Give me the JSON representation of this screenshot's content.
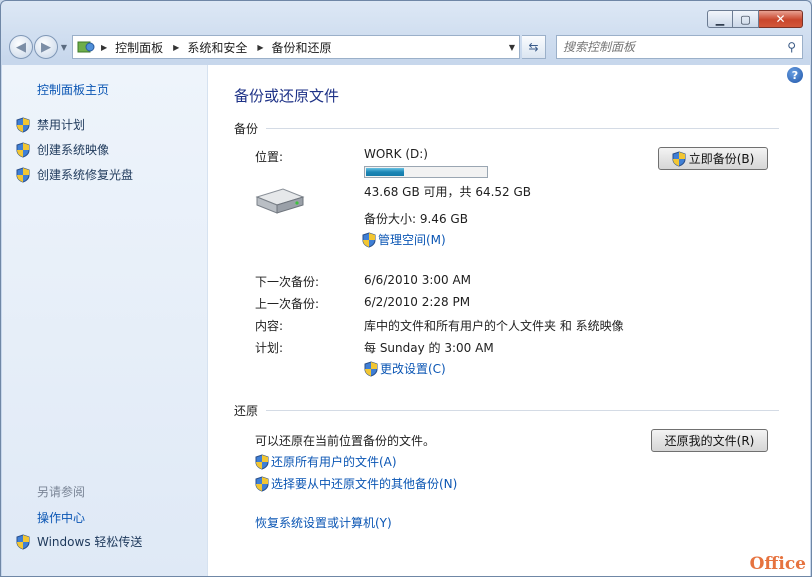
{
  "address": {
    "crumbs": [
      "控制面板",
      "系统和安全",
      "备份和还原"
    ],
    "search_placeholder": "搜索控制面板"
  },
  "sidebar": {
    "home": "控制面板主页",
    "tasks": [
      "禁用计划",
      "创建系统映像",
      "创建系统修复光盘"
    ],
    "see_also_title": "另请参阅",
    "see_also": [
      "操作中心",
      "Windows 轻松传送"
    ]
  },
  "main": {
    "title": "备份或还原文件",
    "backup_section": "备份",
    "location_label": "位置:",
    "drive_name": "WORK (D:)",
    "drive_used_fraction": 0.32,
    "space_text": "43.68 GB 可用，共 64.52 GB",
    "backup_size": "备份大小: 9.46 GB",
    "manage_space": "管理空间(M)",
    "next_label": "下一次备份:",
    "next_value": "6/6/2010 3:00 AM",
    "last_label": "上一次备份:",
    "last_value": "6/2/2010 2:28 PM",
    "contents_label": "内容:",
    "contents_value": "库中的文件和所有用户的个人文件夹 和 系统映像",
    "schedule_label": "计划:",
    "schedule_value": "每 Sunday 的 3:00 AM",
    "change_settings": "更改设置(C)",
    "backup_now": "立即备份(B)",
    "restore_section": "还原",
    "restore_text": "可以还原在当前位置备份的文件。",
    "restore_all_users": "还原所有用户的文件(A)",
    "select_other": "选择要从中还原文件的其他备份(N)",
    "recover_system": "恢复系统设置或计算机(Y)",
    "restore_my_files": "还原我的文件(R)"
  },
  "watermark": "Office"
}
